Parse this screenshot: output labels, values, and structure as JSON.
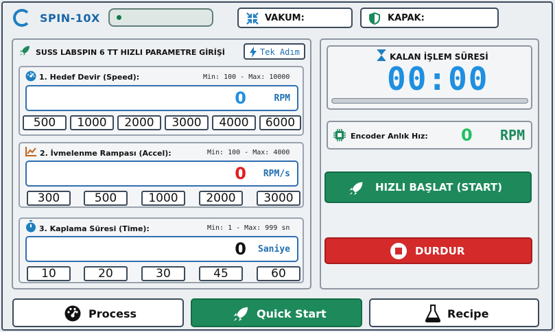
{
  "header": {
    "app_title": "SPIN-10X",
    "vakum_label": "VAKUM:",
    "kapak_label": "KAPAK:"
  },
  "params_panel": {
    "title": "SUSS LABSPIN 6 TT HIZLI PARAMETRE GİRİŞİ",
    "tek_adim_label": "Tek Adım",
    "speed": {
      "title": "1. Hedef Devir (Speed):",
      "range": "Min: 100 - Max: 10000",
      "value": "0",
      "unit": "RPM",
      "presets": [
        "500",
        "1000",
        "2000",
        "3000",
        "4000",
        "6000"
      ],
      "value_color": "#1f8fe0"
    },
    "accel": {
      "title": "2. İvmelenme Rampası (Accel):",
      "range": "Min: 100 - Max: 4000",
      "value": "0",
      "unit": "RPM/s",
      "presets": [
        "300",
        "500",
        "1000",
        "2000",
        "3000"
      ],
      "value_color": "#e02020"
    },
    "time": {
      "title": "3. Kaplama Süresi (Time):",
      "range": "Min: 1 - Max: 999 sn",
      "value": "0",
      "unit": "Saniye",
      "presets": [
        "10",
        "20",
        "30",
        "45",
        "60"
      ],
      "value_color": "#111111"
    }
  },
  "status_panel": {
    "remaining_label": "KALAN İŞLEM SÜRESİ",
    "remaining_time": "00:00",
    "remaining_progress": 0,
    "encoder_label": "Encoder Anlık Hız:",
    "encoder_value": "0",
    "encoder_unit": "RPM",
    "start_label": "HIZLI BAŞLAT (START)",
    "stop_label": "DURDUR"
  },
  "nav": {
    "process_label": "Process",
    "quick_start_label": "Quick Start",
    "recipe_label": "Recipe",
    "active": "quick_start"
  },
  "colors": {
    "accent_blue": "#1f7fc0",
    "green": "#1e8a5c",
    "red": "#d42a2a"
  }
}
